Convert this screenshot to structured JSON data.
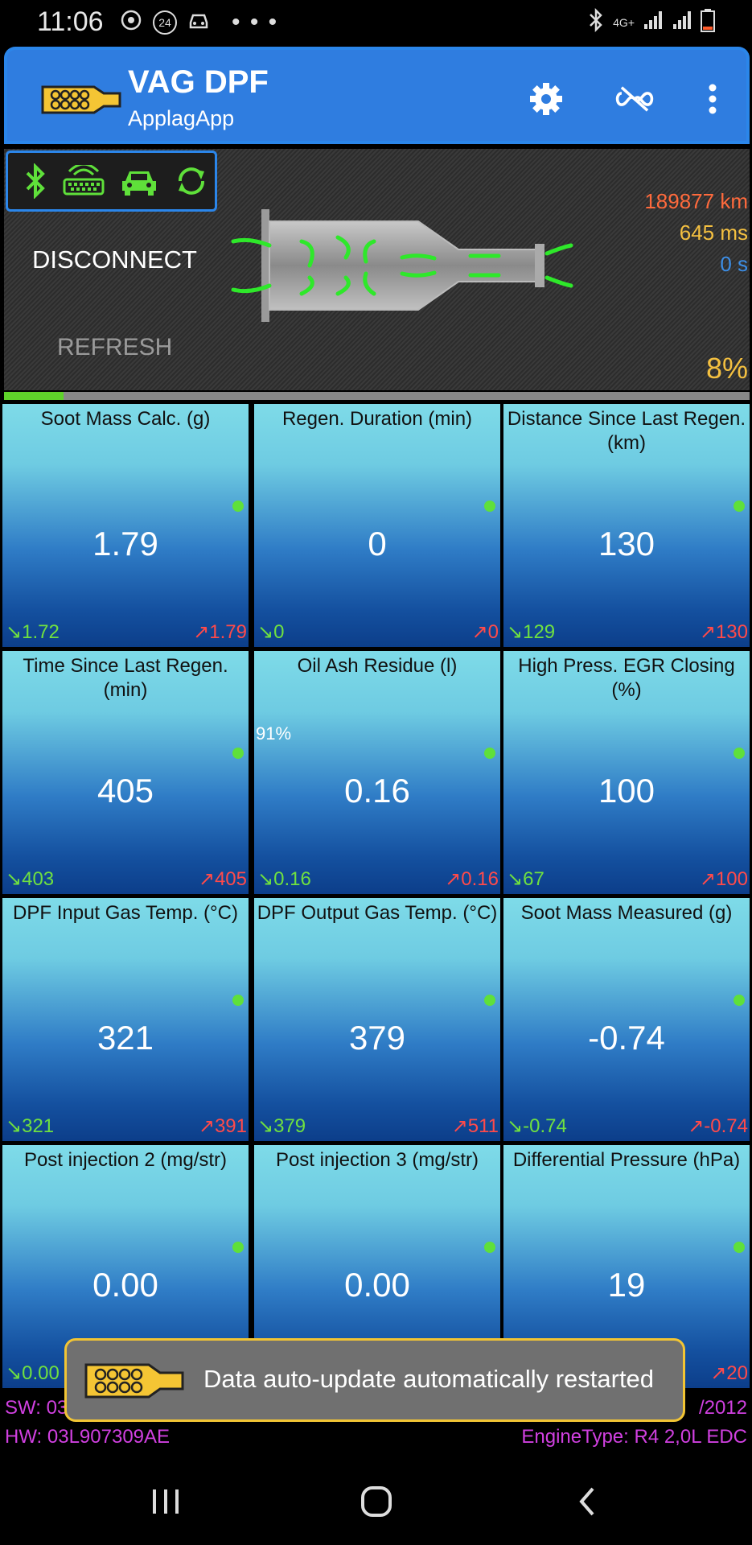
{
  "status_bar": {
    "time": "11:06",
    "icons": [
      "connected-devices-icon",
      "24h-icon",
      "car-icon",
      "more-dots-icon",
      "bluetooth-icon",
      "4g-icon",
      "signal-icon",
      "signal-icon",
      "battery-low-icon"
    ],
    "badge_24": "24",
    "dots": "• • •"
  },
  "app_bar": {
    "title": "VAG DPF",
    "subtitle": "ApplagApp"
  },
  "header": {
    "disconnect_label": "DISCONNECT",
    "refresh_label": "REFRESH",
    "distance": "189877 km",
    "response_time": "645 ms",
    "elapsed": "0 s",
    "percent": "8%",
    "progress_fraction": 0.08
  },
  "tiles": [
    {
      "title": "Soot Mass Calc. (g)",
      "value": "1.79",
      "min": "↘1.72",
      "max": "↗1.79"
    },
    {
      "title": "Regen. Duration (min)",
      "value": "0",
      "min": "↘0",
      "max": "↗0"
    },
    {
      "title": "Distance Since Last Regen. (km)",
      "value": "130",
      "min": "↘129",
      "max": "↗130"
    },
    {
      "title": "Time Since Last Regen. (min)",
      "value": "405",
      "min": "↘403",
      "max": "↗405"
    },
    {
      "title": "Oil Ash Residue (l)",
      "value": "0.16",
      "min": "↘0.16",
      "max": "↗0.16",
      "extra": "91%"
    },
    {
      "title": "High Press. EGR Closing (%)",
      "value": "100",
      "min": "↘67",
      "max": "↗100"
    },
    {
      "title": "DPF Input Gas Temp. (°C)",
      "value": "321",
      "min": "↘321",
      "max": "↗391"
    },
    {
      "title": "DPF Output Gas Temp. (°C)",
      "value": "379",
      "min": "↘379",
      "max": "↗511"
    },
    {
      "title": "Soot Mass Measured (g)",
      "value": "-0.74",
      "min": "↘-0.74",
      "max": "↗-0.74"
    },
    {
      "title": "Post injection 2 (mg/str)",
      "value": "0.00",
      "min": "↘0.00",
      "max": ""
    },
    {
      "title": "Post injection 3 (mg/str)",
      "value": "0.00",
      "min": "",
      "max": ""
    },
    {
      "title": "Differential Pressure (hPa)",
      "value": "19",
      "min": "",
      "max": "↗20"
    }
  ],
  "footer": {
    "sw": "SW: 03",
    "sw_date": "/2012",
    "hw": "HW: 03L907309AE",
    "engine": "EngineType: R4 2,0L EDC"
  },
  "toast": {
    "message": "Data auto-update automatically restarted"
  },
  "colors": {
    "accent": "#2f7de0",
    "min_green": "#6fe040",
    "max_red": "#ff4a4a",
    "footer_magenta": "#d040e0",
    "toast_border": "#f2c534"
  }
}
